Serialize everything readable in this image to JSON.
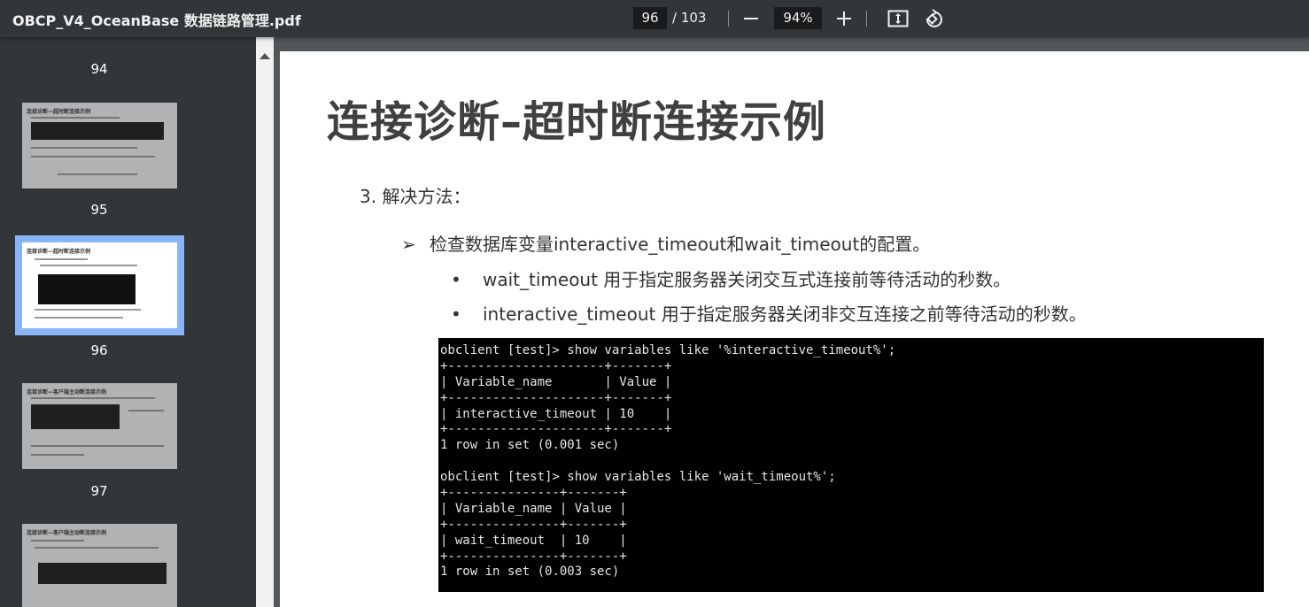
{
  "toolbar": {
    "title": "OBCP_V4_OceanBase 数据链路管理.pdf",
    "current_page": "96",
    "total_pages": "/ 103",
    "zoom": "94%"
  },
  "sidebar": {
    "page_labels": [
      "94",
      "95",
      "96",
      "97"
    ],
    "thumb_titles": [
      "连接诊断—超时断连接示例",
      "连接诊断—超时断连接示例",
      "连接诊断—客户端主动断连接示例",
      "连接诊断—客户端主动断连接示例"
    ]
  },
  "slide": {
    "title": "连接诊断–超时断连接示例",
    "step": "3. 解决方法：",
    "bullet_arrow": "➢",
    "check": "检查数据库变量interactive_timeout和wait_timeout的配置。",
    "dot": "•",
    "bullet1": "wait_timeout 用于指定服务器关闭交互式连接前等待活动的秒数。",
    "bullet2": "interactive_timeout 用于指定服务器关闭非交互连接之前等待活动的秒数。",
    "terminal": [
      "obclient [test]> show variables like '%interactive_timeout%';",
      "+---------------------+-------+",
      "| Variable_name       | Value |",
      "+---------------------+-------+",
      "| interactive_timeout | 10    |",
      "+---------------------+-------+",
      "1 row in set (0.001 sec)",
      "",
      "obclient [test]> show variables like 'wait_timeout%';",
      "+---------------+-------+",
      "| Variable_name | Value |",
      "+---------------+-------+",
      "| wait_timeout  | 10    |",
      "+---------------+-------+",
      "1 row in set (0.003 sec)"
    ]
  }
}
